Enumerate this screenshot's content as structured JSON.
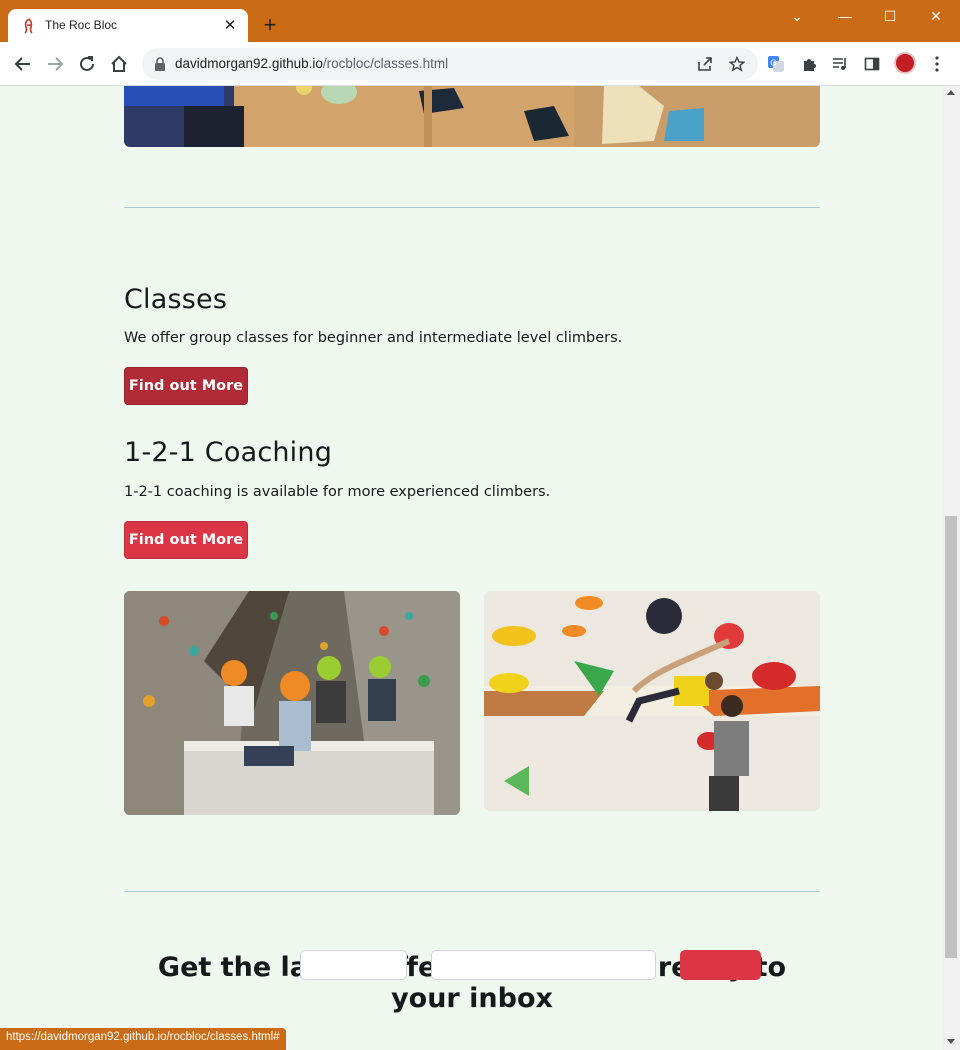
{
  "browser": {
    "tab_title": "The Roc Bloc",
    "tab_close": "✕",
    "new_tab": "+",
    "url_host": "davidmorgan92.github.io",
    "url_path": "/rocbloc/classes.html",
    "window_controls": {
      "chevron": "⌄",
      "minimize": "—",
      "maximize": "☐",
      "close": "✕"
    },
    "accent_color": "#cc6b16",
    "status_url": "https://davidmorgan92.github.io/rocbloc/classes.html#"
  },
  "page": {
    "classes": {
      "title": "Classes",
      "text": "We offer group classes for beginner and intermediate level climbers.",
      "button": "Find out More"
    },
    "coaching": {
      "title": "1-2-1 Coaching",
      "text": "1-2-1 coaching is available for more experienced climbers.",
      "button": "Find out More"
    },
    "photos": [
      {
        "alt": "Children with helmets sitting on a crash mat in a climbing gym"
      },
      {
        "alt": "Climber on a bouldering wall with a spotter"
      }
    ],
    "newsletter": {
      "title": "Get the latest offers and news directly to your inbox"
    },
    "colors": {
      "background": "#eff8ee",
      "button_dark": "#b02a37",
      "button_red": "#dc3545",
      "divider": "#a9ccd0"
    }
  }
}
